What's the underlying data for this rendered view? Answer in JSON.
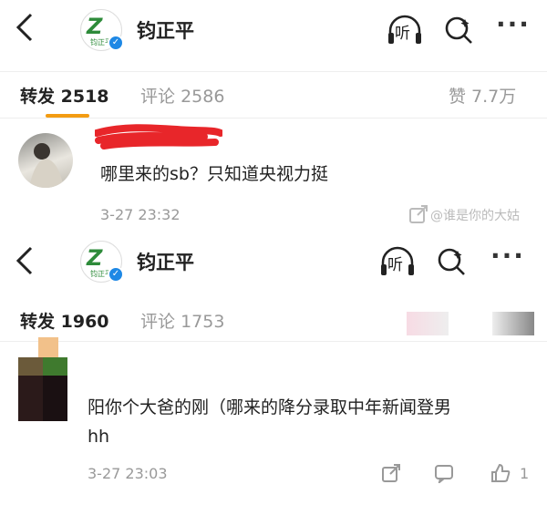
{
  "screenshot1": {
    "header": {
      "account_name": "钧正平",
      "logo_text": "钧正平",
      "listen_label": "听"
    },
    "tabs": {
      "repost": "转发",
      "repost_count": "2518",
      "comment": "评论",
      "comment_count": "2586",
      "likes": "赞 7.7万"
    },
    "comment": {
      "text": "哪里来的sb？只知道央视力挺",
      "time": "3-27 23:32"
    },
    "watermark": "@谁是你的大姑"
  },
  "screenshot2": {
    "header": {
      "account_name": "钧正平",
      "logo_text": "钧正平",
      "listen_label": "听"
    },
    "tabs": {
      "repost": "转发",
      "repost_count": "1960",
      "comment": "评论",
      "comment_count": "1753"
    },
    "comment": {
      "line1": "阳你个大爸的刚（哪来的降分录取中年新闻登男",
      "line2": "hh",
      "time": "3-27 23:03",
      "like_count": "1"
    }
  },
  "colors": {
    "accent": "#f39c12",
    "verified": "#1e88e5",
    "logo_green": "#2e8b3a",
    "censor_red": "#e8262a"
  },
  "icons": [
    "chevron-left-icon",
    "headphones-icon",
    "search-icon",
    "more-icon",
    "share-icon",
    "comment-icon",
    "like-icon"
  ]
}
